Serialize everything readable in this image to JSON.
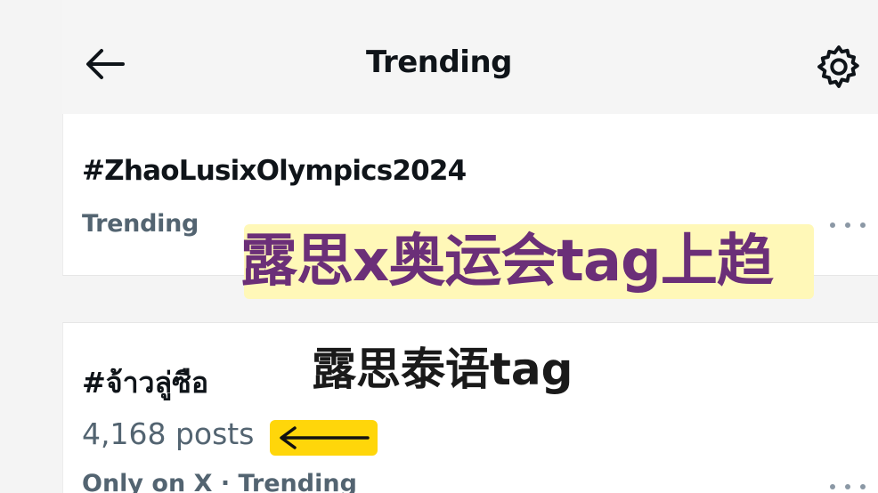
{
  "header": {
    "title": "Trending",
    "back_icon": "arrow-left-icon",
    "settings_icon": "gear-icon"
  },
  "trends": [
    {
      "title": "#ZhaoLusixOlympics2024",
      "meta": "Trending",
      "more_icon": "more-horizontal-icon"
    },
    {
      "title": "#จ้าวลู่ซือ",
      "posts": "4,168 posts",
      "meta": "Only on X · Trending",
      "more_icon": "more-horizontal-icon"
    }
  ],
  "annotations": {
    "caption1": "露思x奥运会tag上趋",
    "caption1_color": "#6b2f78",
    "caption1_highlight": "#fff8b8",
    "caption2": "露思泰语tag",
    "arrow_icon": "long-arrow-left-icon",
    "arrow_badge_color": "#ffd60a"
  }
}
